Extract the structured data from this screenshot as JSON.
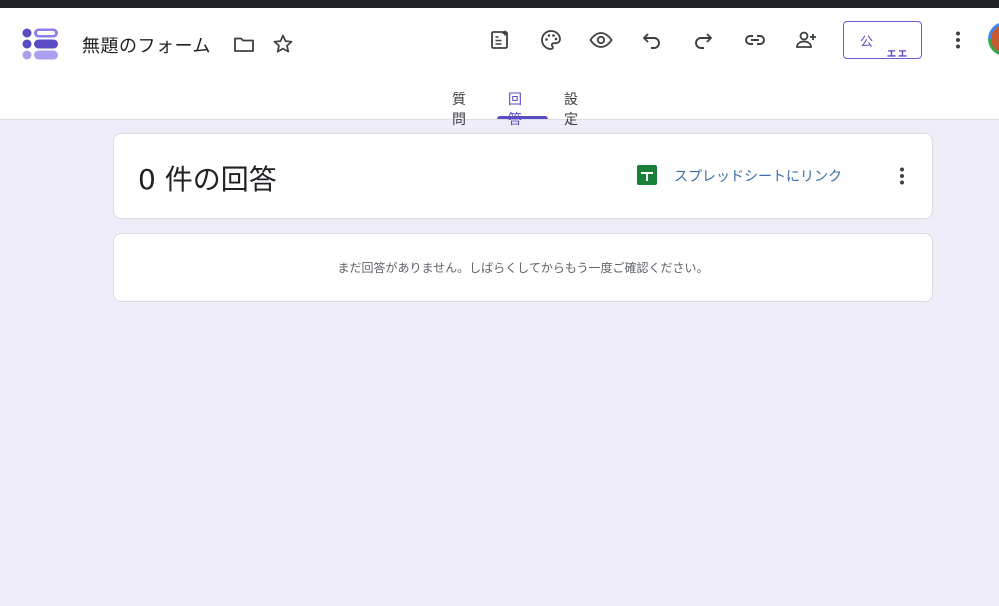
{
  "header": {
    "title": "無題のフォーム",
    "publish_label": "公",
    "publish_glyph": "ェェ"
  },
  "toolbar_icons": [
    "ai-summary-icon",
    "palette-icon",
    "preview-eye-icon",
    "undo-icon",
    "redo-icon",
    "link-icon",
    "add-collaborator-icon",
    "more-vert-icon"
  ],
  "tabs": [
    {
      "label": "質問",
      "active": false
    },
    {
      "label": "回答",
      "active": true
    },
    {
      "label": "設定",
      "active": false
    }
  ],
  "responses": {
    "count_label": "0 件の回答",
    "sheet_link_label": "スプレッドシートにリンク",
    "empty_message": "まだ回答がありません。しばらくしてからもう一度ご確認ください。"
  },
  "colors": {
    "accent": "#5a4cc4",
    "background": "#efedf9",
    "sheets_green": "#188038",
    "link_blue": "#3c6eaa"
  }
}
